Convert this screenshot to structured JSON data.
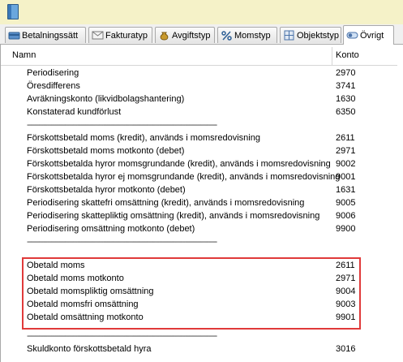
{
  "tabs": [
    {
      "label": "Betalningssätt",
      "icon": "payment-card-icon"
    },
    {
      "label": "Fakturatyp",
      "icon": "envelope-icon"
    },
    {
      "label": "Avgiftstyp",
      "icon": "money-bag-icon"
    },
    {
      "label": "Momstyp",
      "icon": "percent-icon"
    },
    {
      "label": "Objektstyp",
      "icon": "object-grid-icon"
    },
    {
      "label": "Övrigt",
      "icon": "toggle-icon"
    }
  ],
  "active_tab": "Övrigt",
  "table": {
    "headers": {
      "name": "Namn",
      "konto": "Konto"
    },
    "rows": [
      {
        "name": "Periodisering",
        "konto": "2970"
      },
      {
        "name": "Öresdifferens",
        "konto": "3741"
      },
      {
        "name": "Avräkningskonto (likvidbolagshantering)",
        "konto": "1630"
      },
      {
        "name": "Konstaterad kundförlust",
        "konto": "6350"
      },
      {
        "name": "-----------------------------------------------------------------------------------------------",
        "konto": ""
      },
      {
        "name": "Förskottsbetald moms (kredit), används i momsredovisning",
        "konto": "2611"
      },
      {
        "name": "Förskottsbetald moms motkonto (debet)",
        "konto": "2971"
      },
      {
        "name": "Förskottsbetalda hyror momsgrundande (kredit), används i momsredovisning",
        "konto": "9002"
      },
      {
        "name": "Förskottsbetalda hyror ej momsgrundande (kredit), används i momsredovisning",
        "konto": "9001"
      },
      {
        "name": "Förskottsbetalda hyror motkonto (debet)",
        "konto": "1631"
      },
      {
        "name": "Periodisering skattefri omsättning (kredit), används i momsredovisning",
        "konto": "9005"
      },
      {
        "name": "Periodisering skattepliktig omsättning (kredit), används i momsredovisning",
        "konto": "9006"
      },
      {
        "name": "Periodisering omsättning motkonto (debet)",
        "konto": "9900"
      },
      {
        "name": "-----------------------------------------------------------------------------------------------",
        "konto": ""
      },
      {
        "name": "Obetald moms",
        "konto": "2611"
      },
      {
        "name": "Obetald moms motkonto",
        "konto": "2971"
      },
      {
        "name": "Obetald momspliktig omsättning",
        "konto": "9004"
      },
      {
        "name": "Obetald momsfri omsättning",
        "konto": "9003"
      },
      {
        "name": "Obetald omsättning motkonto",
        "konto": "9901"
      },
      {
        "name": "-----------------------------------------------------------------------------------------------",
        "konto": ""
      },
      {
        "name": "Skuldkonto förskottsbetald hyra",
        "konto": "3016"
      }
    ]
  },
  "colors": {
    "highlight_border": "#e03a3a",
    "titlebar_bg": "#f5f2c8"
  }
}
